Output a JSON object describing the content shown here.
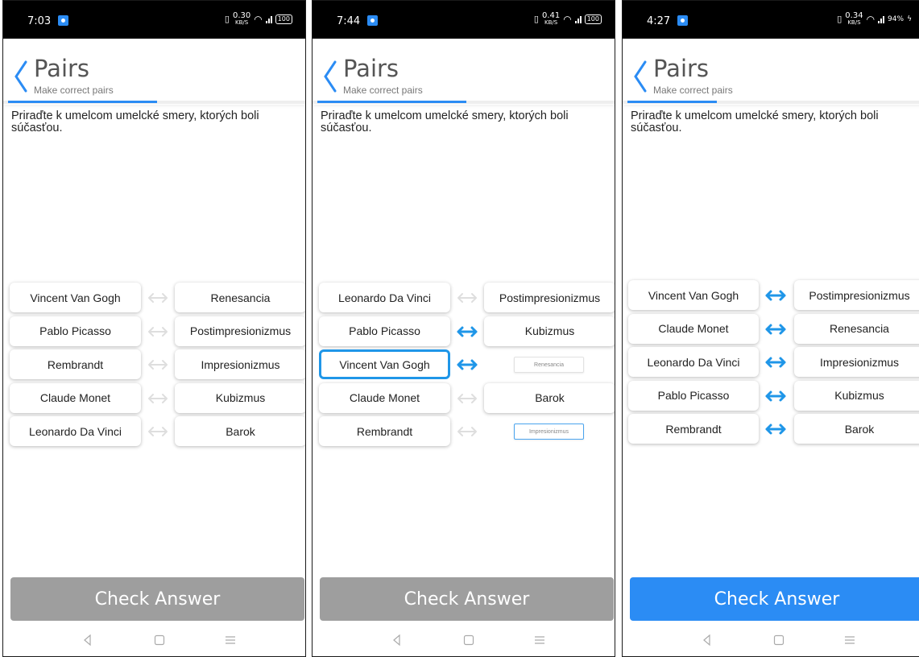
{
  "app": {
    "title": "Pairs",
    "subtitle": "Make correct pairs",
    "question": "Priraďte k umelcom umelcké smery, ktorých boli súčasťou.",
    "check_label": "Check Answer",
    "accent_color": "#2b8cf4",
    "disabled_color": "#9e9e9e"
  },
  "screens": [
    {
      "status": {
        "time": "7:03",
        "speed": "0.30",
        "speed_unit": "KB/S",
        "battery": "100"
      },
      "progress": 0.5,
      "check_enabled": false,
      "pairs": [
        {
          "left": "Vincent Van Gogh",
          "right": "Renesancia",
          "linked": false
        },
        {
          "left": "Pablo Picasso",
          "right": "Postimpresionizmus",
          "linked": false
        },
        {
          "left": "Rembrandt",
          "right": "Impresionizmus",
          "linked": false
        },
        {
          "left": "Claude Monet",
          "right": "Kubizmus",
          "linked": false
        },
        {
          "left": "Leonardo Da Vinci",
          "right": "Barok",
          "linked": false
        }
      ]
    },
    {
      "status": {
        "time": "7:44",
        "speed": "0.41",
        "speed_unit": "KB/S",
        "battery": "100"
      },
      "progress": 0.5,
      "check_enabled": false,
      "pairs": [
        {
          "left": "Leonardo Da Vinci",
          "right": "Postimpresionizmus",
          "linked": false
        },
        {
          "left": "Pablo Picasso",
          "right": "Kubizmus",
          "linked": true
        },
        {
          "left": "Vincent Van Gogh",
          "right": "Renesancia",
          "linked": true,
          "left_selected": true,
          "right_dragging": true
        },
        {
          "left": "Claude Monet",
          "right": "Barok",
          "linked": false
        },
        {
          "left": "Rembrandt",
          "right": "Impresionizmus",
          "linked": false,
          "right_dragging": true,
          "right_highlight": true
        }
      ]
    },
    {
      "status": {
        "time": "4:27",
        "speed": "0.34",
        "speed_unit": "KB/S",
        "battery": "94%"
      },
      "progress": 0.3,
      "check_enabled": true,
      "pairs": [
        {
          "left": "Vincent Van Gogh",
          "right": "Postimpresionizmus",
          "linked": true
        },
        {
          "left": "Claude Monet",
          "right": "Renesancia",
          "linked": true
        },
        {
          "left": "Leonardo Da Vinci",
          "right": "Impresionizmus",
          "linked": true
        },
        {
          "left": "Pablo Picasso",
          "right": "Kubizmus",
          "linked": true
        },
        {
          "left": "Rembrandt",
          "right": "Barok",
          "linked": true
        }
      ]
    }
  ]
}
